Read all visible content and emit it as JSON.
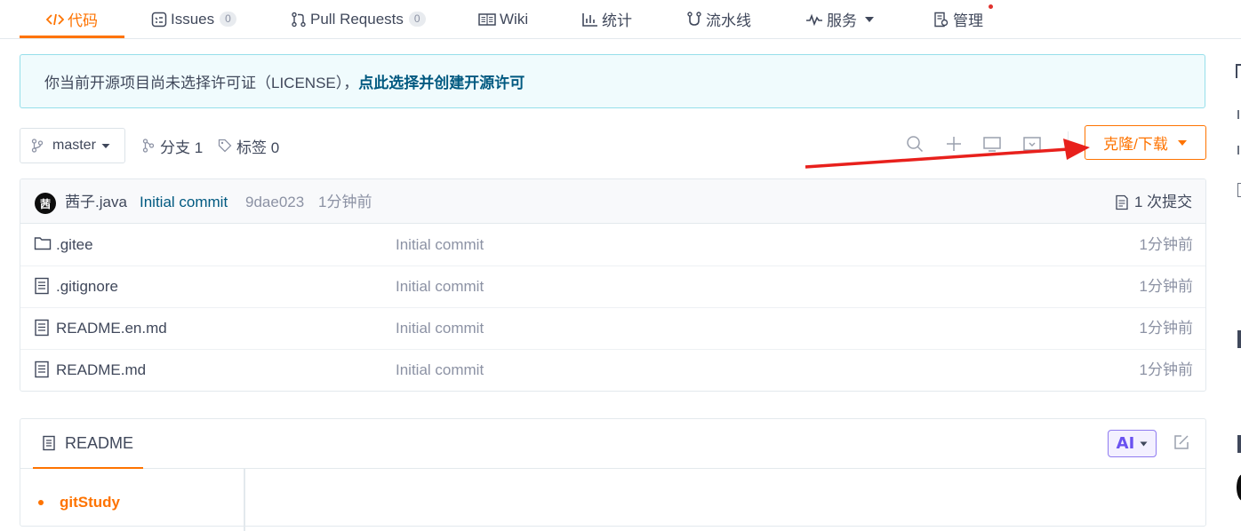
{
  "nav": {
    "tabs": [
      {
        "label": "代码",
        "icon": "code-icon"
      },
      {
        "label": "Issues",
        "badge": "0",
        "icon": "issues-icon"
      },
      {
        "label": "Pull Requests",
        "badge": "0",
        "icon": "pull-request-icon"
      },
      {
        "label": "Wiki",
        "icon": "book-icon"
      },
      {
        "label": "统计",
        "icon": "bar-chart-icon"
      },
      {
        "label": "流水线",
        "icon": "pipeline-icon"
      },
      {
        "label": "服务",
        "icon": "pulse-icon"
      },
      {
        "label": "管理",
        "icon": "manage-icon"
      }
    ]
  },
  "license_notice": {
    "text": "你当前开源项目尚未选择许可证（LICENSE），",
    "link": "点此选择并创建开源许可"
  },
  "repo": {
    "branch": "master",
    "branches_label": "分支 1",
    "tags_label": "标签 0",
    "clone_button": "克隆/下载"
  },
  "latest_commit": {
    "avatar_char": "茜",
    "author": "茜子.java",
    "message": "Initial commit",
    "hash": "9dae023",
    "time": "1分钟前",
    "count_label": "1 次提交"
  },
  "files": [
    {
      "name": ".gitee",
      "type": "folder",
      "message": "Initial commit",
      "time": "1分钟前"
    },
    {
      "name": ".gitignore",
      "type": "file",
      "message": "Initial commit",
      "time": "1分钟前"
    },
    {
      "name": "README.en.md",
      "type": "file",
      "message": "Initial commit",
      "time": "1分钟前"
    },
    {
      "name": "README.md",
      "type": "file",
      "message": "Initial commit",
      "time": "1分钟前"
    }
  ],
  "readme": {
    "tab_label": "README",
    "ai_label": "AI",
    "toc": [
      "gitStudy"
    ]
  },
  "colors": {
    "accent": "#fe7300",
    "annotation_arrow": "#e8201c",
    "link": "#005980"
  }
}
